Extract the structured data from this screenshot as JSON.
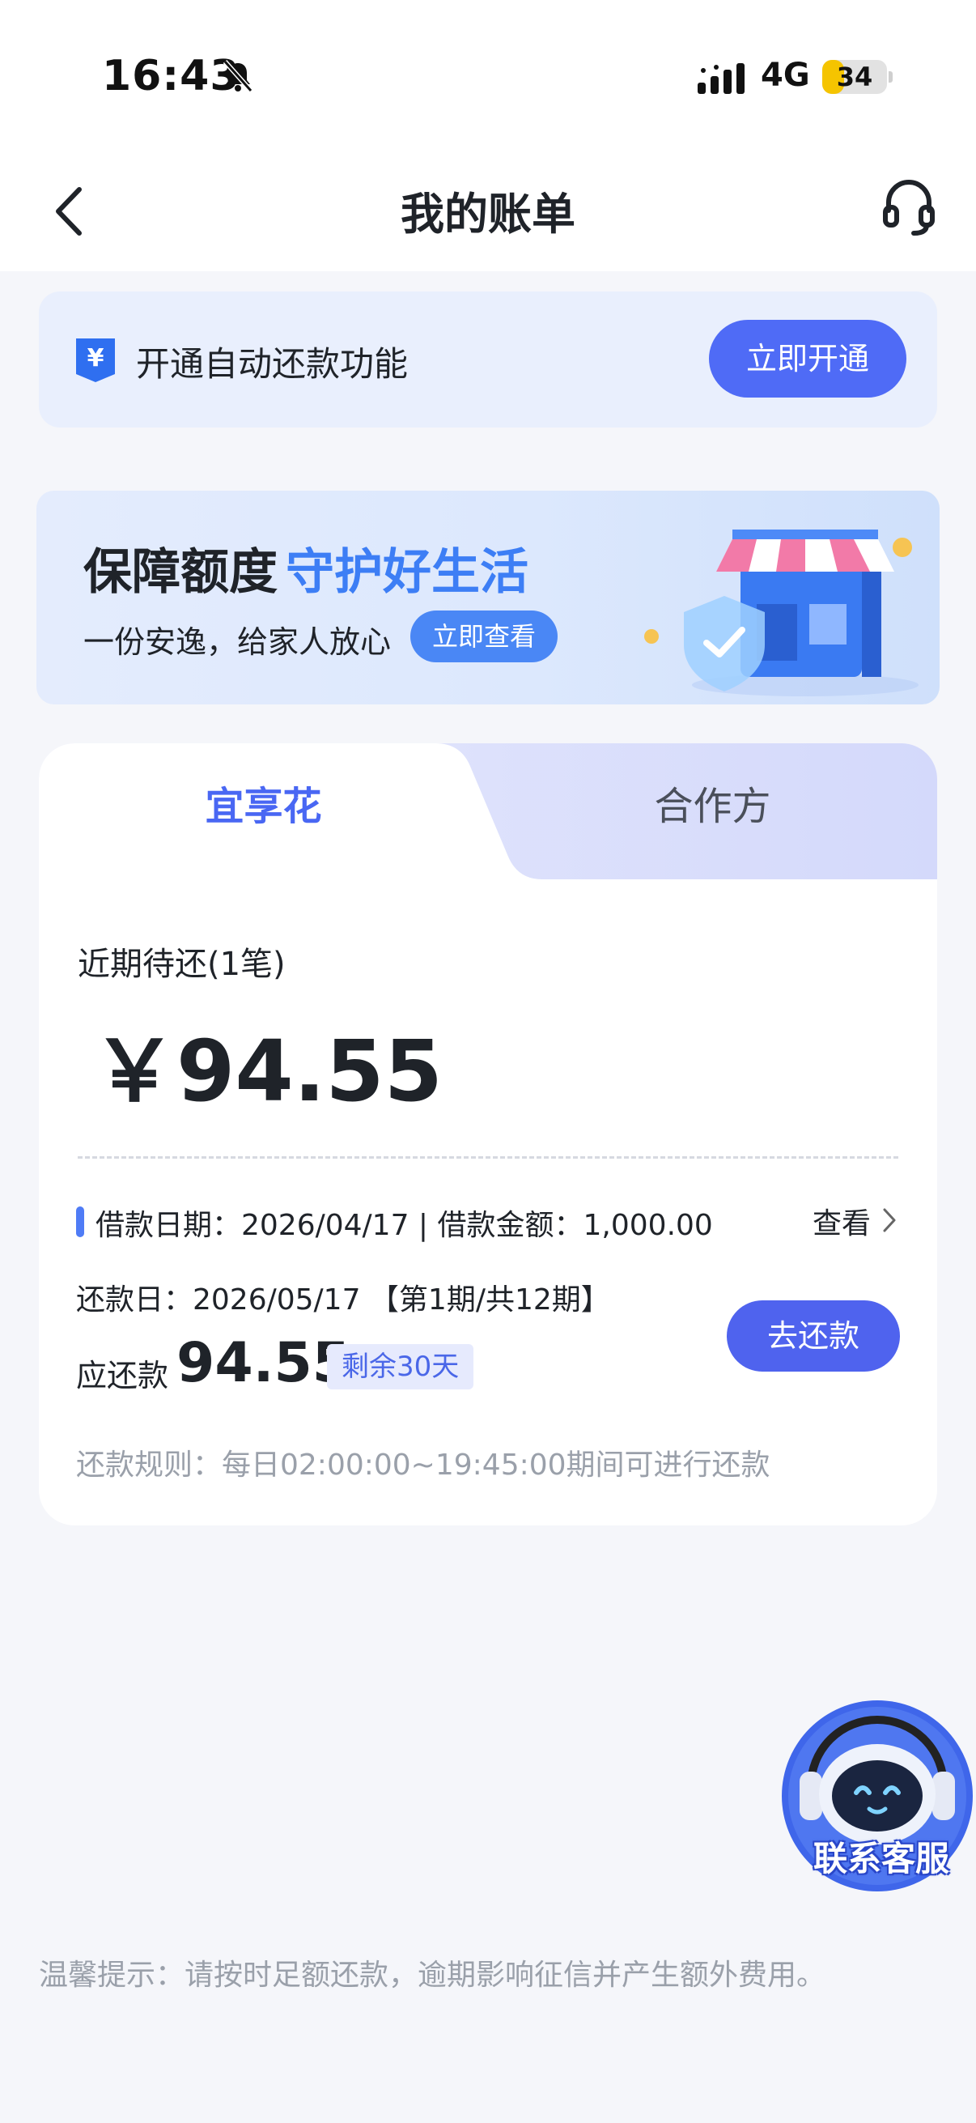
{
  "status_bar": {
    "time": "16:43",
    "network": "4G",
    "battery": "34",
    "battery_level": 0.34
  },
  "nav": {
    "title": "我的账单",
    "back_icon": "chevron-left-icon",
    "service_icon": "headset-icon"
  },
  "autopay": {
    "text": "开通自动还款功能",
    "button": "立即开通",
    "icon": "yen-shield-icon"
  },
  "banner": {
    "title_a": "保障额度",
    "title_b": "守护好生活",
    "subtitle": "一份安逸，给家人放心",
    "button": "立即查看"
  },
  "tabs": [
    {
      "label": "宜享花",
      "active": true
    },
    {
      "label": "合作方",
      "active": false
    }
  ],
  "bill": {
    "pending_label": "近期待还(1笔)",
    "amount": "￥94.55",
    "loan_info": "借款日期：2026/04/17 | 借款金额：1,000.00",
    "view_label": "查看",
    "due_line": "还款日：2026/05/17 【第1期/共12期】",
    "should_label": "应还款",
    "should_amount": "94.55",
    "remaining": "剩余30天",
    "repay_button": "去还款",
    "rule": "还款规则：每日02:00:00~19:45:00期间可进行还款"
  },
  "service_bubble": {
    "label": "联系客服"
  },
  "tip": "温馨提示：请按时足额还款，逾期影响征信并产生额外费用。",
  "colors": {
    "primary": "#4f63ee",
    "accent_blue": "#3d7ef5",
    "page_bg": "#f5f6fa"
  }
}
